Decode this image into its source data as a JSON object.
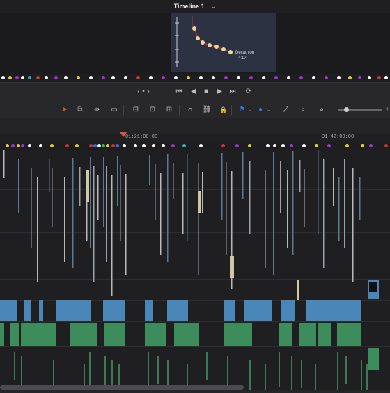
{
  "window": {
    "title": "Timeline 1"
  },
  "ruler": {
    "timecodes": [
      "01:21:00:00",
      "01:42:00:00"
    ]
  },
  "preview": {
    "label_line1": "Decathlon",
    "label_line2": "4:17"
  },
  "icons": {
    "title_chevron": "chevron-down-icon",
    "nav_prev": "‹",
    "nav_dot": "•",
    "nav_next": "›",
    "first_frame": "⏮",
    "reverse": "◀",
    "stop": "■",
    "play": "▶",
    "last_frame": "⏭",
    "loop": "⟳",
    "select": "➤",
    "trim": "⧉",
    "dynamic_trim": "⇹",
    "blade": "▭",
    "insert": "⊟",
    "overwrite": "⊡",
    "replace": "⊞",
    "snap": "∩",
    "link": "⛓",
    "lock": "🔒",
    "flag": "⚑",
    "marker": "●",
    "zoom_full": "⤢",
    "zoom_detail": "⌕",
    "zoom_custom": "⌕",
    "minus": "−",
    "plus": "+"
  },
  "colors": {
    "accent_red": "#d64541",
    "flag_blue": "#2f7ae5",
    "video_blue": "#4a86b8",
    "audio_green": "#3d8c5c"
  }
}
